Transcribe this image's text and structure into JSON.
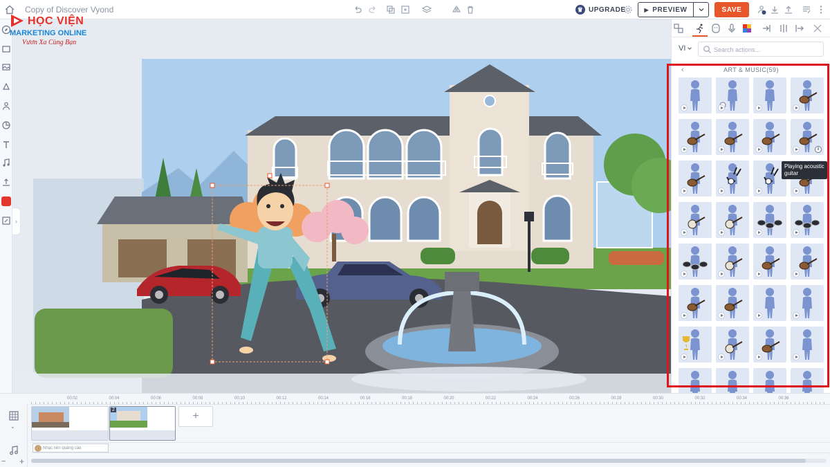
{
  "topbar": {
    "doc_title": "Copy of Discover Vyond",
    "upgrade_label": "UPGRADE",
    "preview_label": "PREVIEW",
    "save_label": "SAVE"
  },
  "logo": {
    "line1": "HỌC VIỆN",
    "line2": "MARKETING ONLINE",
    "line3": "Vươn Xa Cùng Bạn"
  },
  "panel": {
    "language": "VI",
    "search_placeholder": "Search actions...",
    "category_label": "ART & MUSIC(59)",
    "tooltip": "Playing acoustic guitar",
    "actions": [
      {
        "prop": "none"
      },
      {
        "prop": "search"
      },
      {
        "prop": "none"
      },
      {
        "prop": "guitar"
      },
      {
        "prop": "guitar"
      },
      {
        "prop": "guitar"
      },
      {
        "prop": "guitar"
      },
      {
        "prop": "guitar"
      },
      {
        "prop": "guitar"
      },
      {
        "prop": "bagpipe"
      },
      {
        "prop": "bagpipe"
      },
      {
        "prop": "guitar"
      },
      {
        "prop": "banjo"
      },
      {
        "prop": "banjo"
      },
      {
        "prop": "drums"
      },
      {
        "prop": "drums"
      },
      {
        "prop": "drums"
      },
      {
        "prop": "banjo"
      },
      {
        "prop": "guitar"
      },
      {
        "prop": "guitar"
      },
      {
        "prop": "guitar"
      },
      {
        "prop": "guitar"
      },
      {
        "prop": "none"
      },
      {
        "prop": "none"
      },
      {
        "prop": "trophy"
      },
      {
        "prop": "banjo"
      },
      {
        "prop": "guitar"
      },
      {
        "prop": "none"
      },
      {
        "prop": "none"
      },
      {
        "prop": "none"
      },
      {
        "prop": "none"
      },
      {
        "prop": "none"
      }
    ]
  },
  "timeline": {
    "ticks": [
      "00:02",
      "00:04",
      "00:06",
      "00:08",
      "00:10",
      "00:12",
      "00:14",
      "00:16",
      "00:18",
      "00:20",
      "00:22",
      "00:24",
      "00:26",
      "00:28",
      "00:30",
      "00:32",
      "00:34",
      "00:36"
    ],
    "scene2_number": "2",
    "audio_label": "Nhạc nền quảng cáo"
  },
  "colors": {
    "accent": "#e8572a",
    "highlight": "#e0141c",
    "thumb_bg": "#dfe7f5",
    "figure": "#7b94cf"
  }
}
